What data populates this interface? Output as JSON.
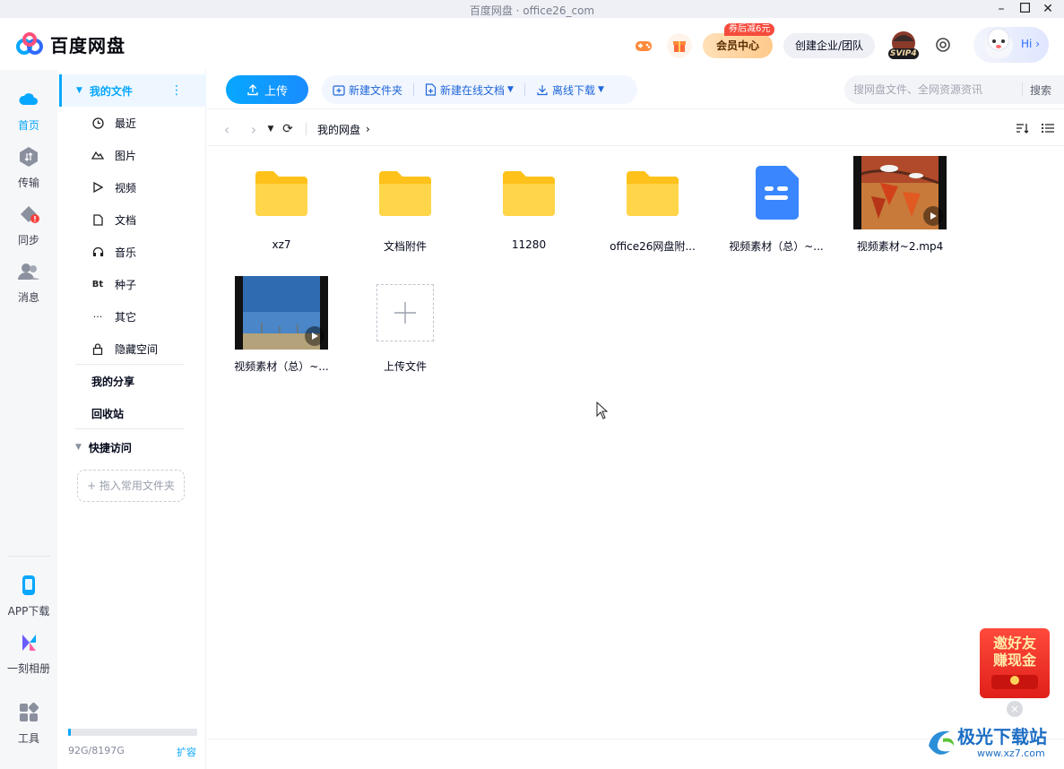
{
  "window": {
    "title": "百度网盘 · office26_com"
  },
  "header": {
    "brand": "百度网盘",
    "coupon_badge": "券后减6元",
    "vip_center": "会员中心",
    "create_team": "创建企业/团队",
    "svip_badge": "SVIP4",
    "hi_label": "Hi",
    "accent": "#06a7ff"
  },
  "leftnav": {
    "items": [
      {
        "label": "首页",
        "icon": "cloud-icon"
      },
      {
        "label": "传输",
        "icon": "transfer-icon"
      },
      {
        "label": "同步",
        "icon": "sync-icon"
      },
      {
        "label": "消息",
        "icon": "message-icon"
      }
    ],
    "bottom": [
      {
        "label": "APP下载",
        "icon": "phone-icon"
      },
      {
        "label": "一刻相册",
        "icon": "album-icon"
      },
      {
        "label": "工具",
        "icon": "tools-icon"
      }
    ]
  },
  "sidebar": {
    "my_files": "我的文件",
    "items": [
      {
        "label": "最近",
        "icon": "clock-icon"
      },
      {
        "label": "图片",
        "icon": "image-icon"
      },
      {
        "label": "视频",
        "icon": "play-icon"
      },
      {
        "label": "文档",
        "icon": "document-icon"
      },
      {
        "label": "音乐",
        "icon": "headphones-icon"
      },
      {
        "label": "种子",
        "icon": "bt-icon"
      },
      {
        "label": "其它",
        "icon": "more-icon"
      },
      {
        "label": "隐藏空间",
        "icon": "lock-icon"
      }
    ],
    "my_share": "我的分享",
    "recycle": "回收站",
    "quick_access": "快捷访问",
    "drag_hint": "+ 拖入常用文件夹",
    "quota": "92G/8197G",
    "quota_fraction": 0.011,
    "expand": "扩容"
  },
  "toolbar": {
    "upload": "上传",
    "new_folder": "新建文件夹",
    "new_online_doc": "新建在线文档",
    "offline_download": "离线下载",
    "search_placeholder": "搜网盘文件、全网资源资讯",
    "search_button": "搜索"
  },
  "breadcrumb": {
    "root": "我的网盘"
  },
  "files": [
    {
      "name": "xz7",
      "type": "folder"
    },
    {
      "name": "文档附件",
      "type": "folder"
    },
    {
      "name": "11280",
      "type": "folder"
    },
    {
      "name": "office26网盘附...",
      "type": "folder"
    },
    {
      "name": "视频素材（总）~...",
      "type": "doc"
    },
    {
      "name": "视频素材~2.mp4",
      "type": "video"
    },
    {
      "name": "视频素材（总）~...",
      "type": "video"
    },
    {
      "name": "上传文件",
      "type": "upload"
    }
  ],
  "promo": {
    "line1": "邀好友",
    "line2": "赚现金"
  },
  "watermark": {
    "title": "极光下载站",
    "sub": "www.xz7.com"
  }
}
